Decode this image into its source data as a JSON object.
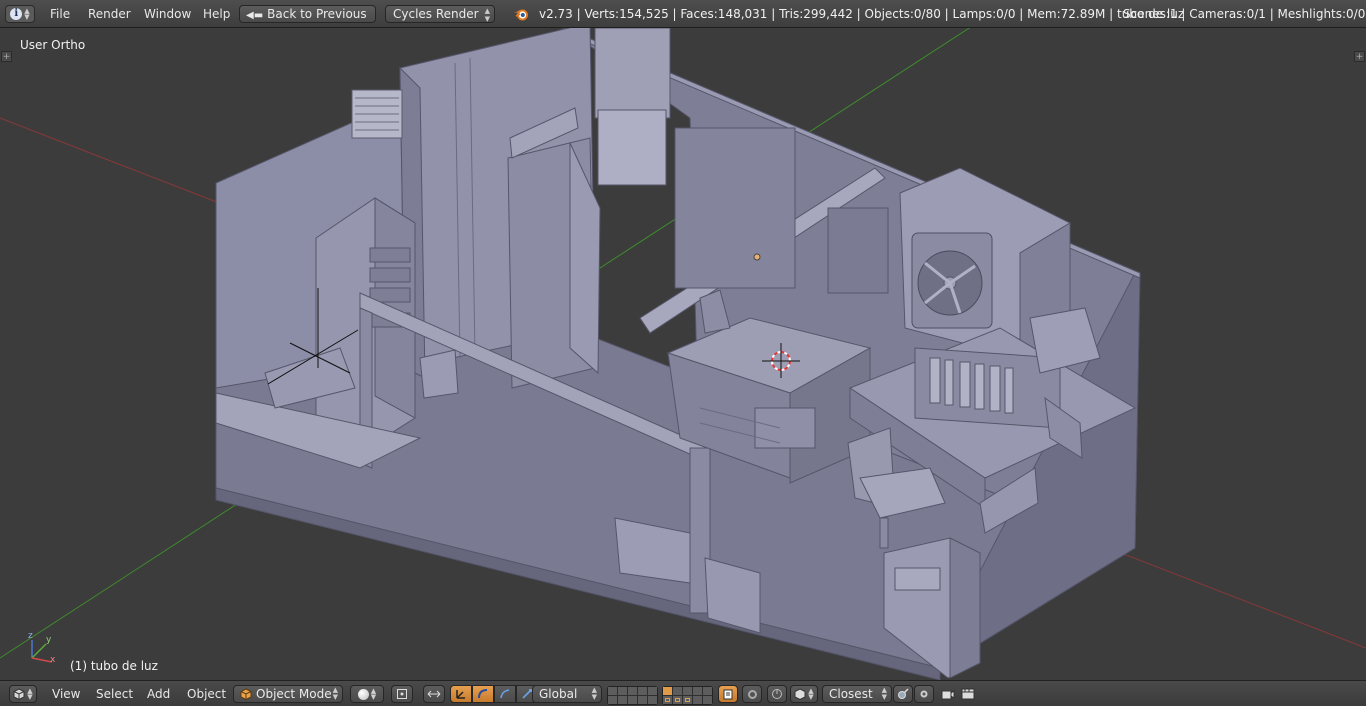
{
  "top_header": {
    "menu": [
      "File",
      "Render",
      "Window",
      "Help"
    ],
    "back_button": "Back to Previous",
    "render_engine": "Cycles Render",
    "stats": "v2.73 | Verts:154,525 | Faces:148,031 | Tris:299,442 | Objects:0/80 | Lamps:0/0 | Mem:72.89M | tubo de luz",
    "scene_stats": "Scenes:1 | Cameras:0/1 | Meshlights:0/0"
  },
  "viewport": {
    "view_name": "User Ortho",
    "active_object": "(1) tubo de luz",
    "axis_labels": {
      "x": "x",
      "y": "y",
      "z": "z"
    }
  },
  "bottom_header": {
    "menu": [
      "View",
      "Select",
      "Add",
      "Object"
    ],
    "mode": "Object Mode",
    "orientation": "Global",
    "snap_target": "Closest"
  },
  "colors": {
    "viewport_bg": "#3c3c3c",
    "model": "#8e8ea6",
    "accent": "#d58734",
    "x_axis": "#9a3a3a",
    "y_axis": "#4e9a32"
  },
  "icons": [
    "info-icon",
    "blender-logo",
    "back-arrow-icon",
    "editor-cube-icon",
    "object-mode-cube-icon",
    "shading-sphere-icon",
    "pivot-icon",
    "manipulator-icon",
    "translate-icon",
    "rotate-icon",
    "scale-icon",
    "layers-grid",
    "lock-camera-icon",
    "proportional-icon",
    "snap-icon",
    "snap-element-icon",
    "render-preview-icon",
    "render-anim-icon"
  ]
}
